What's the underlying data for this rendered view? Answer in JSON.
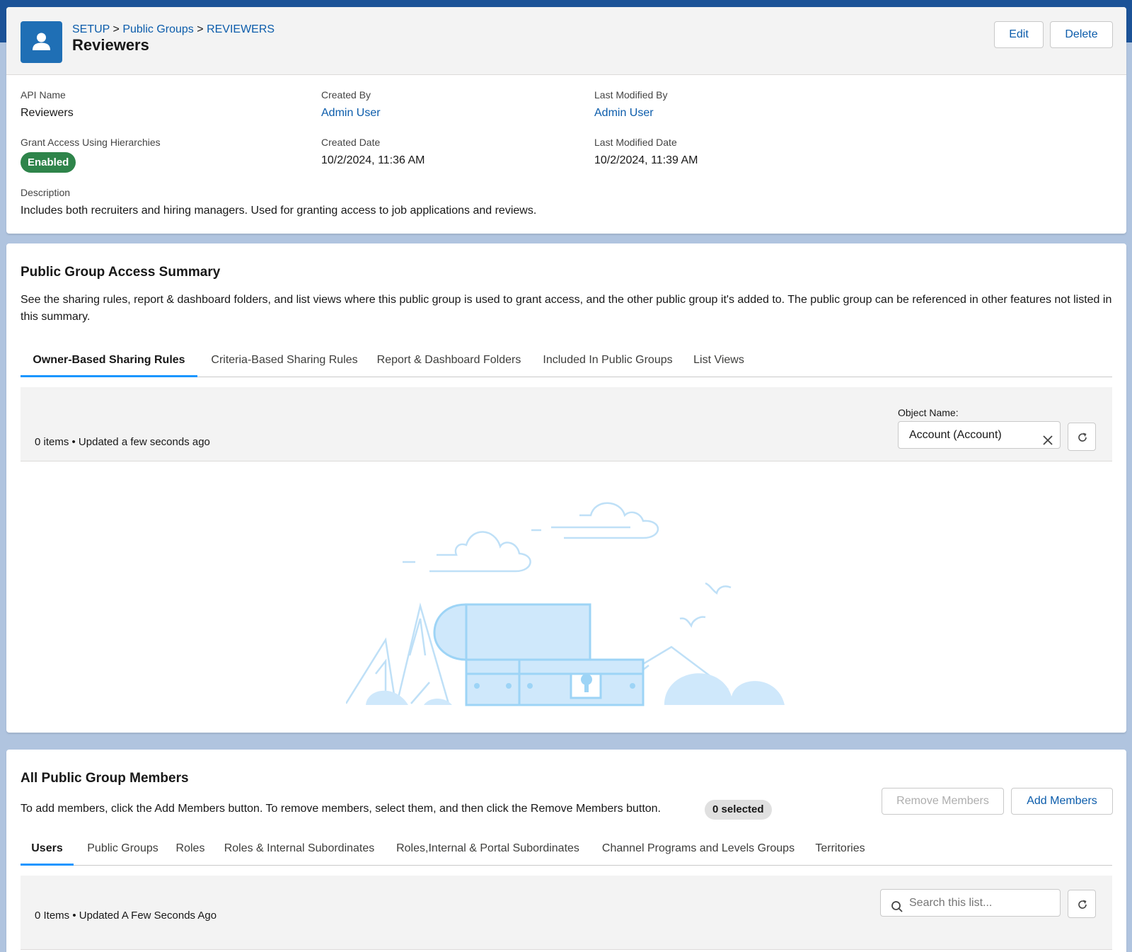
{
  "header": {
    "breadcrumb": [
      "SETUP",
      "Public Groups",
      "REVIEWERS"
    ],
    "breadcrumb_sep": ">",
    "title": "Reviewers",
    "edit_label": "Edit",
    "delete_label": "Delete",
    "icon": "user-icon"
  },
  "details": {
    "api_name_label": "API Name",
    "api_name_value": "Reviewers",
    "created_by_label": "Created By",
    "created_by_value": "Admin User",
    "last_modified_by_label": "Last Modified By",
    "last_modified_by_value": "Admin User",
    "grant_access_label": "Grant Access Using Hierarchies",
    "grant_access_value": "Enabled",
    "created_date_label": "Created Date",
    "created_date_value": "10/2/2024, 11:36 AM",
    "last_modified_date_label": "Last Modified Date",
    "last_modified_date_value": "10/2/2024, 11:39 AM",
    "description_label": "Description",
    "description_value": "Includes both recruiters and hiring managers. Used for granting access to job applications and reviews."
  },
  "summary": {
    "title": "Public Group Access Summary",
    "description": "See the sharing rules, report & dashboard folders, and list views where this public group is used to grant access, and the other public group it's added to. The public group can be referenced in other features not listed in this summary.",
    "tabs": [
      {
        "label": "Owner-Based Sharing Rules",
        "active": true
      },
      {
        "label": "Criteria-Based Sharing Rules",
        "active": false
      },
      {
        "label": "Report & Dashboard Folders",
        "active": false
      },
      {
        "label": "Included In Public Groups",
        "active": false
      },
      {
        "label": "List Views",
        "active": false
      }
    ],
    "list_meta": "0 items • Updated a few seconds ago",
    "object_name_label": "Object Name:",
    "object_name_value": "Account (Account)"
  },
  "members": {
    "title": "All Public Group Members",
    "description": "To add members, click the Add Members button. To remove members, select them, and then click the Remove Members button.",
    "selected_badge": "0 selected",
    "remove_label": "Remove Members",
    "add_label": "Add Members",
    "tabs": [
      {
        "label": "Users",
        "active": true
      },
      {
        "label": "Public Groups",
        "active": false
      },
      {
        "label": "Roles",
        "active": false
      },
      {
        "label": "Roles & Internal Subordinates",
        "active": false
      },
      {
        "label": "Roles,Internal & Portal Subordinates",
        "active": false
      },
      {
        "label": "Channel Programs and Levels Groups",
        "active": false
      },
      {
        "label": "Territories",
        "active": false
      }
    ],
    "list_meta": "0 Items • Updated A Few Seconds Ago",
    "search_placeholder": "Search this list..."
  },
  "colors": {
    "brand_blue": "#0b5cab",
    "enabled_green": "#2e844a",
    "active_tab": "#1b96ff"
  }
}
